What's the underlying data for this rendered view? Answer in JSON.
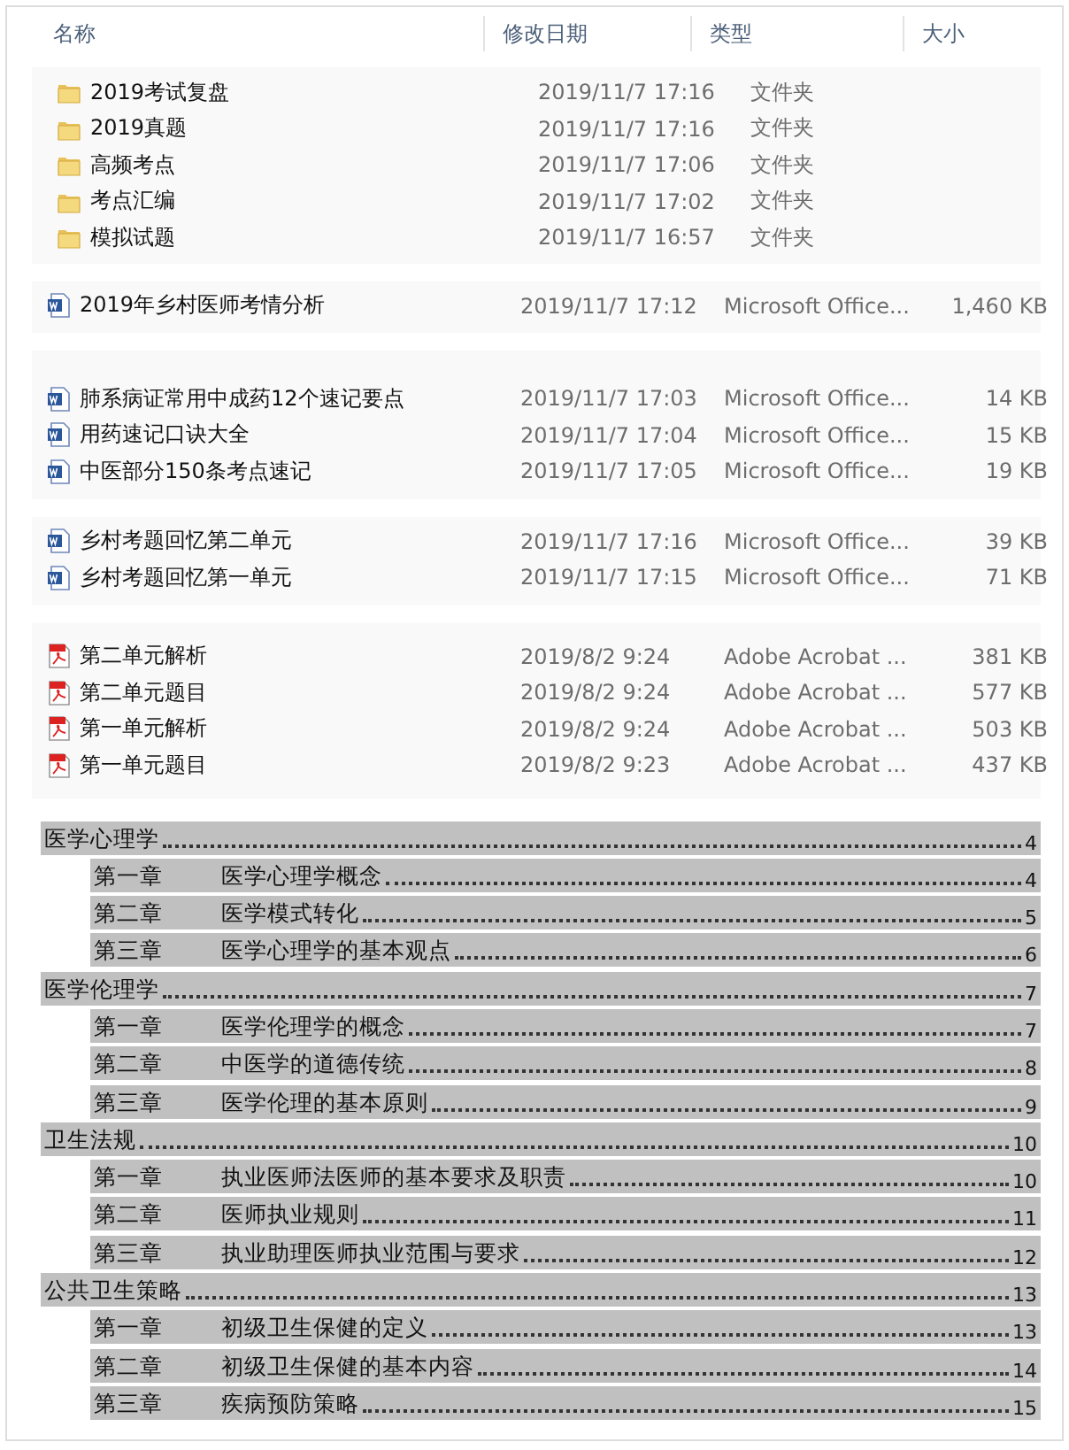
{
  "columns": [
    "名称",
    "修改日期",
    "类型",
    "大小"
  ],
  "file_groups": [
    {
      "files": [
        {
          "kind": "folder",
          "name": "2019考试复盘",
          "date": "2019/11/7 17:16",
          "type": "文件夹"
        },
        {
          "kind": "folder",
          "name": "2019真题",
          "date": "2019/11/7 17:16",
          "type": "文件夹"
        },
        {
          "kind": "folder",
          "name": "高频考点",
          "date": "2019/11/7 17:06",
          "type": "文件夹"
        },
        {
          "kind": "folder",
          "name": "考点汇编",
          "date": "2019/11/7 17:02",
          "type": "文件夹"
        },
        {
          "kind": "folder",
          "name": "模拟试题",
          "date": "2019/11/7 16:57",
          "type": "文件夹"
        }
      ]
    },
    {
      "files": [
        {
          "kind": "word",
          "name": "2019年乡村医师考情分析",
          "date": "2019/11/7 17:12",
          "type": "Microsoft Office...",
          "size": "1,460 KB"
        }
      ]
    },
    {
      "files": [
        {
          "kind": "word",
          "name": "肺系病证常用中成药12个速记要点",
          "date": "2019/11/7 17:03",
          "type": "Microsoft Office...",
          "size": "14 KB"
        },
        {
          "kind": "word",
          "name": "用药速记口诀大全",
          "date": "2019/11/7 17:04",
          "type": "Microsoft Office...",
          "size": "15 KB"
        },
        {
          "kind": "word",
          "name": "中医部分150条考点速记",
          "date": "2019/11/7 17:05",
          "type": "Microsoft Office...",
          "size": "19 KB"
        }
      ]
    },
    {
      "files": [
        {
          "kind": "word",
          "name": "乡村考题回忆第二单元",
          "date": "2019/11/7 17:16",
          "type": "Microsoft Office...",
          "size": "39 KB"
        },
        {
          "kind": "word",
          "name": "乡村考题回忆第一单元",
          "date": "2019/11/7 17:15",
          "type": "Microsoft Office...",
          "size": "71 KB"
        }
      ]
    },
    {
      "files": [
        {
          "kind": "pdf",
          "name": "第二单元解析",
          "date": "2019/8/2 9:24",
          "type": "Adobe Acrobat ...",
          "size": "381 KB"
        },
        {
          "kind": "pdf",
          "name": "第二单元题目",
          "date": "2019/8/2 9:24",
          "type": "Adobe Acrobat ...",
          "size": "577 KB"
        },
        {
          "kind": "pdf",
          "name": "第一单元解析",
          "date": "2019/8/2 9:24",
          "type": "Adobe Acrobat ...",
          "size": "503 KB"
        },
        {
          "kind": "pdf",
          "name": "第一单元题目",
          "date": "2019/8/2 9:23",
          "type": "Adobe Acrobat ...",
          "size": "437 KB"
        }
      ]
    }
  ],
  "toc": [
    {
      "title": "医学心理学",
      "page": "4",
      "children": [
        {
          "chapter": "第一章",
          "title": "医学心理学概念",
          "page": "4"
        },
        {
          "chapter": "第二章",
          "title": "医学模式转化",
          "page": "5"
        },
        {
          "chapter": "第三章",
          "title": "医学心理学的基本观点",
          "page": "6"
        }
      ]
    },
    {
      "title": "医学伦理学",
      "page": "7",
      "children": [
        {
          "chapter": "第一章",
          "title": "医学伦理学的概念",
          "page": "7"
        },
        {
          "chapter": "第二章",
          "title": "中医学的道德传统",
          "page": "8"
        },
        {
          "chapter": "第三章",
          "title": "医学伦理的基本原则",
          "page": "9"
        }
      ]
    },
    {
      "title": "卫生法规",
      "page": "10",
      "children": [
        {
          "chapter": "第一章",
          "title": "执业医师法医师的基本要求及职责",
          "page": "10"
        },
        {
          "chapter": "第二章",
          "title": "医师执业规则",
          "page": "11"
        },
        {
          "chapter": "第三章",
          "title": "执业助理医师执业范围与要求",
          "page": "12"
        }
      ]
    },
    {
      "title": "公共卫生策略",
      "page": "13",
      "children": [
        {
          "chapter": "第一章",
          "title": "初级卫生保健的定义",
          "page": "13"
        },
        {
          "chapter": "第二章",
          "title": "初级卫生保健的基本内容",
          "page": "14"
        },
        {
          "chapter": "第三章",
          "title": "疾病预防策略",
          "page": "15"
        }
      ]
    }
  ]
}
